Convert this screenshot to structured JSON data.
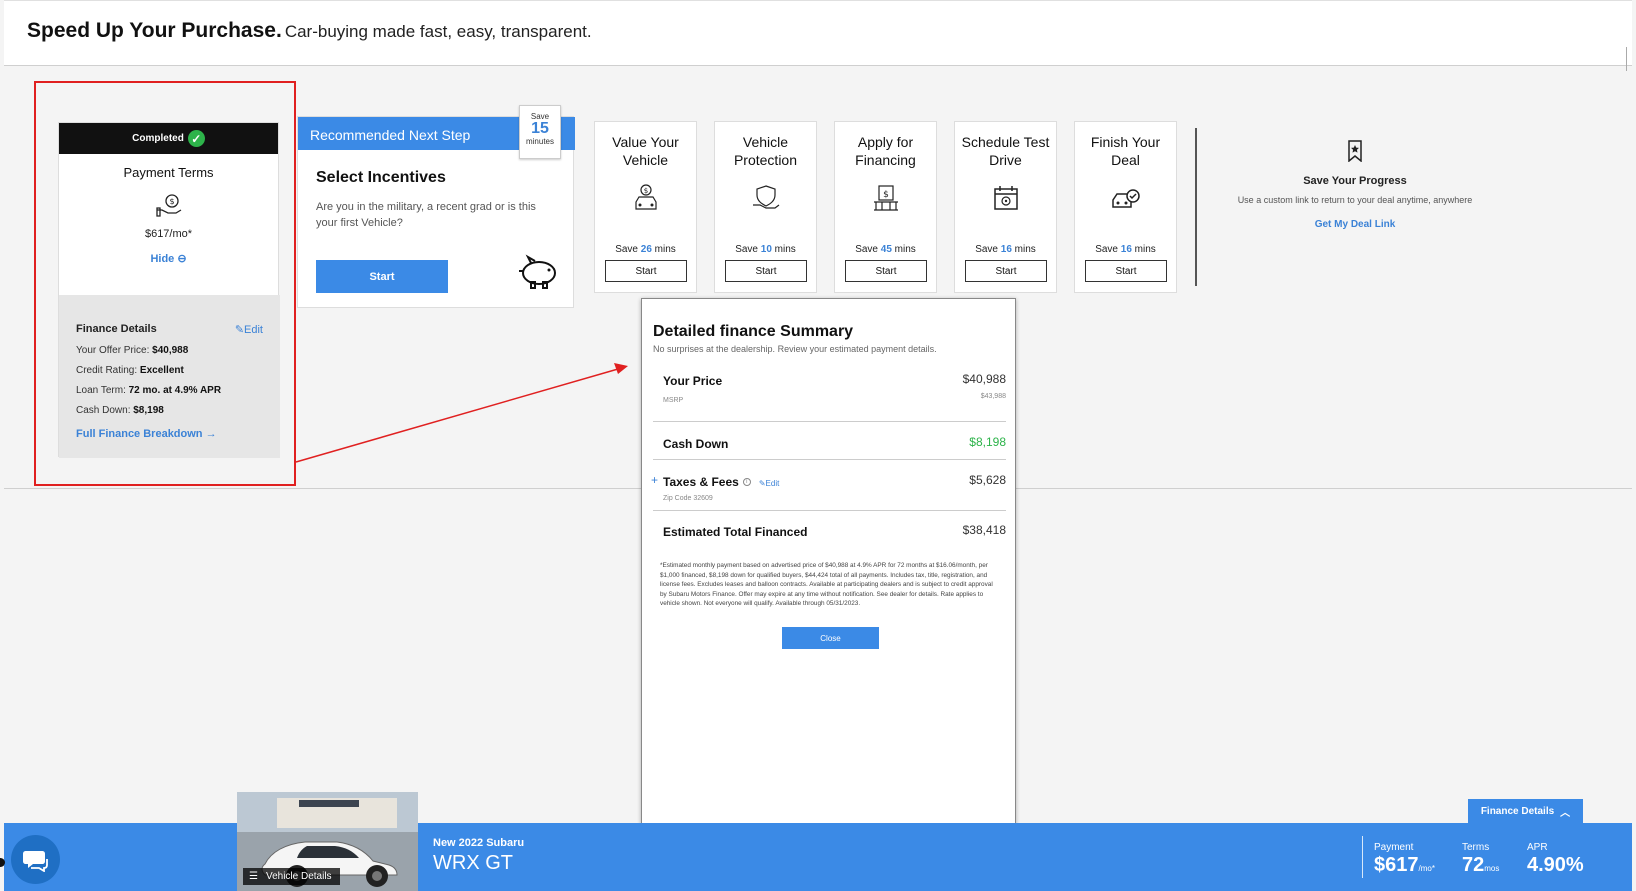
{
  "header": {
    "title": "Speed Up Your Purchase.",
    "tagline": "Car-buying made fast, easy, transparent."
  },
  "payment_terms": {
    "status": "Completed",
    "title": "Payment Terms",
    "amount": "$617/mo*",
    "hide_label": "Hide",
    "finance_details": {
      "heading": "Finance Details",
      "edit_label": "Edit",
      "offer_price_label": "Your Offer Price:",
      "offer_price": "$40,988",
      "credit_label": "Credit Rating:",
      "credit": "Excellent",
      "loan_label": "Loan Term:",
      "loan": "72 mo. at 4.9% APR",
      "cash_label": "Cash Down:",
      "cash": "$8,198",
      "breakdown_link": "Full Finance Breakdown"
    }
  },
  "recommended": {
    "bar_label": "Recommended Next Step",
    "save_top": "Save",
    "save_num": "15",
    "save_unit": "minutes",
    "title": "Select Incentives",
    "text": "Are you in the military, a recent grad or is this your first Vehicle?",
    "start_label": "Start"
  },
  "steps": [
    {
      "title": "Value Your Vehicle",
      "save_prefix": "Save",
      "mins": "26",
      "mins_suffix": "mins",
      "button": "Start",
      "icon": "car-value-icon"
    },
    {
      "title": "Vehicle Protection",
      "save_prefix": "Save",
      "mins": "10",
      "mins_suffix": "mins",
      "button": "Start",
      "icon": "hand-shield-icon"
    },
    {
      "title": "Apply for Financing",
      "save_prefix": "Save",
      "mins": "45",
      "mins_suffix": "mins",
      "button": "Start",
      "icon": "bank-icon"
    },
    {
      "title": "Schedule Test Drive",
      "save_prefix": "Save",
      "mins": "16",
      "mins_suffix": "mins",
      "button": "Start",
      "icon": "calendar-icon"
    },
    {
      "title": "Finish Your Deal",
      "save_prefix": "Save",
      "mins": "16",
      "mins_suffix": "mins",
      "button": "Start",
      "icon": "car-check-icon"
    }
  ],
  "save_progress": {
    "title": "Save Your Progress",
    "text": "Use a custom link to return to your deal anytime, anywhere",
    "link": "Get My Deal Link"
  },
  "modal": {
    "title": "Detailed finance Summary",
    "subtitle": "No surprises at the dealership. Review your estimated payment details.",
    "price_label": "Your Price",
    "price": "$40,988",
    "msrp_label": "MSRP",
    "msrp": "$43,988",
    "cash_label": "Cash Down",
    "cash": "$8,198",
    "taxes_label": "Taxes & Fees",
    "taxes_edit": "Edit",
    "taxes": "$5,628",
    "zip": "Zip Code 32609",
    "total_label": "Estimated Total Financed",
    "total": "$38,418",
    "disclaimer": "*Estimated monthly payment based on advertised price of $40,988 at 4.9% APR for 72 months at $16.06/month, per $1,000 financed, $8,198 down for qualified buyers, $44,424 total of all payments. Includes tax, title, registration, and license fees. Excludes leases and balloon contracts. Available at participating dealers and is subject to credit approval by Subaru Motors Finance. Offer may expire at any time without notification. See dealer for details. Rate applies to vehicle shown. Not everyone will qualify. Available through 05/31/2023.",
    "close_label": "Close"
  },
  "bottom_bar": {
    "vehicle_details_label": "Vehicle Details",
    "car_subtitle": "New 2022 Subaru",
    "car_name": "WRX GT",
    "finance_tab": "Finance Details",
    "payment_label": "Payment",
    "payment": "$617",
    "payment_unit": "/mo*",
    "terms_label": "Terms",
    "terms": "72",
    "terms_unit": "mos",
    "apr_label": "APR",
    "apr": "4.90%"
  },
  "colors": {
    "accent": "#3b8ae6",
    "link": "#3b82d6",
    "success": "#2db34a",
    "annotation": "#e02020"
  }
}
